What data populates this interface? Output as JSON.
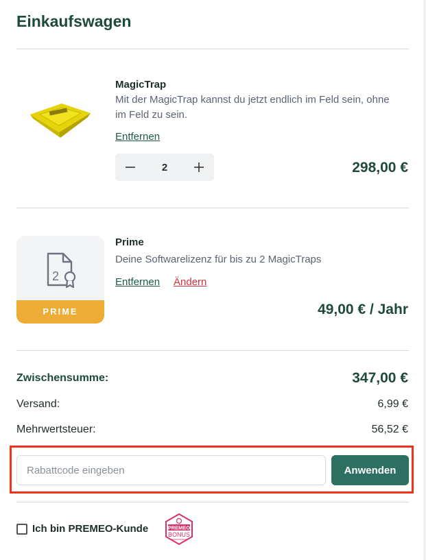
{
  "cart": {
    "title": "Einkaufswagen",
    "items": [
      {
        "name": "MagicTrap",
        "description": "Mit der MagicTrap kannst du jetzt endlich im Feld sein, ohne im Feld zu sein.",
        "remove_label": "Entfernen",
        "quantity": "2",
        "price": "298,00 €",
        "image_icon": "yellow-trap-icon"
      },
      {
        "name": "Prime",
        "description": "Deine Softwarelizenz für bis zu 2 MagicTraps",
        "remove_label": "Entfernen",
        "change_label": "Ändern",
        "price": "49,00 € / Jahr",
        "badge_label": "PRIME",
        "badge_color": "#ecac35",
        "doc_number": "2"
      }
    ]
  },
  "summary": {
    "subtotal_label": "Zwischensumme:",
    "subtotal_value": "347,00 €",
    "shipping_label": "Versand:",
    "shipping_value": "6,99 €",
    "vat_label": "Mehrwertsteuer:",
    "vat_value": "56,52 €"
  },
  "coupon": {
    "placeholder": "Rabattcode eingeben",
    "value": "",
    "apply_label": "Anwenden",
    "highlight_color": "#f03318"
  },
  "premeo": {
    "checkbox_label": "Ich bin PREMEO-Kunde",
    "checked": false,
    "badge_line1": "PREMEO",
    "badge_line2": "BONUS"
  },
  "colors": {
    "brand_green": "#1e4a3c",
    "button_green": "#2d6f60",
    "link_red": "#d6303a"
  }
}
